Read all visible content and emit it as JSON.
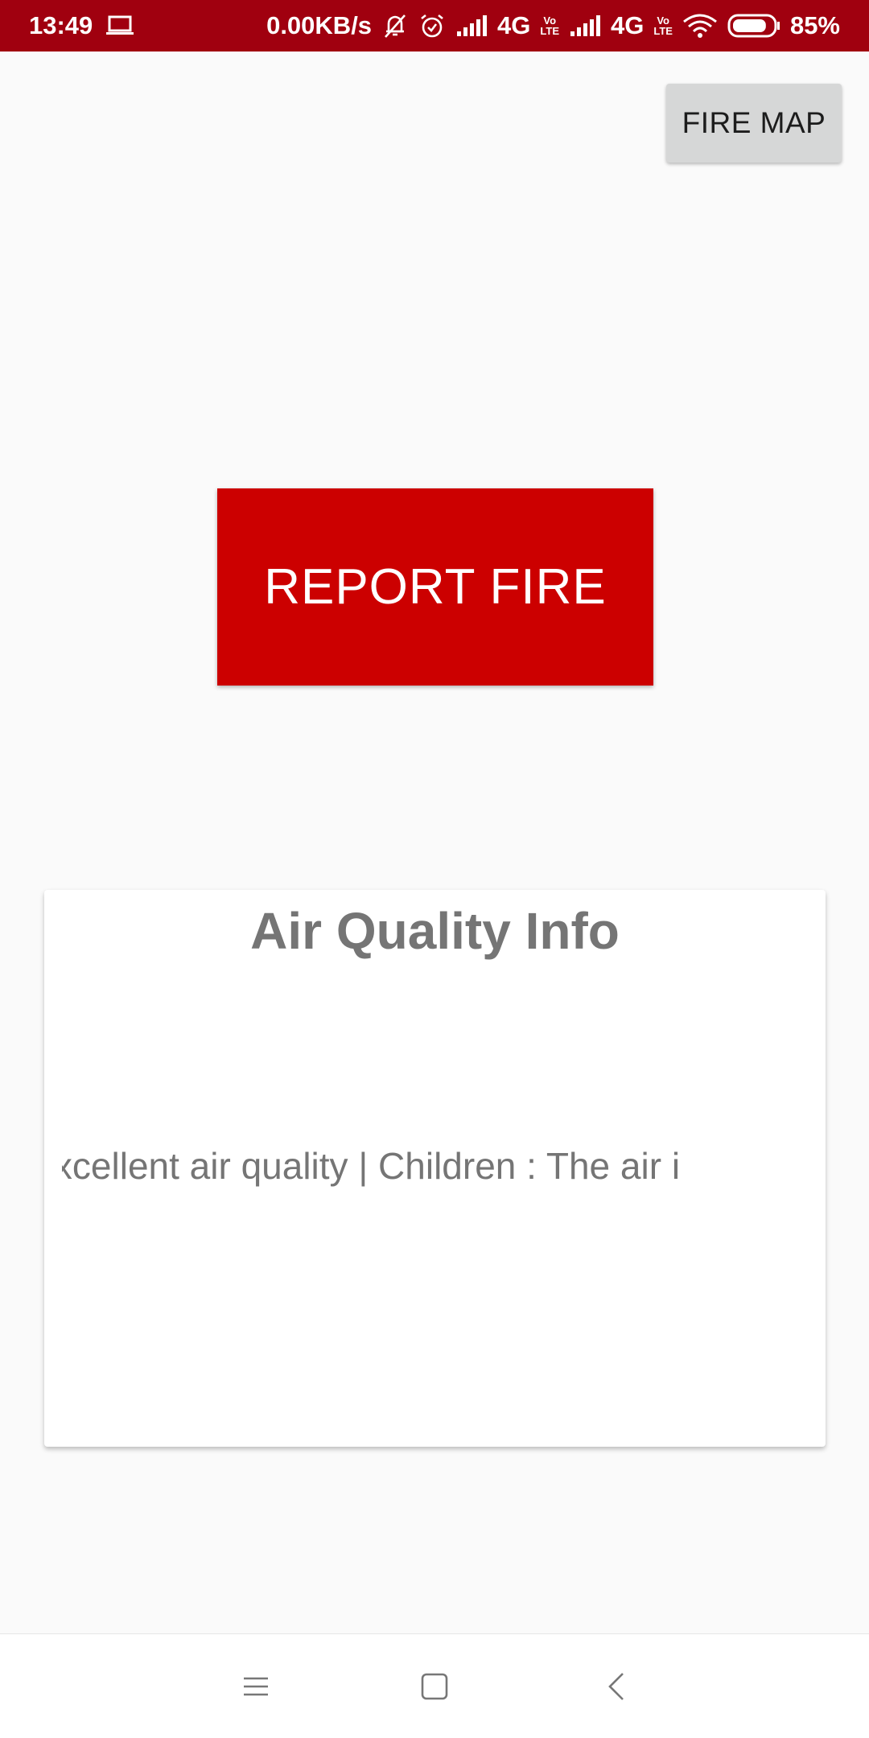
{
  "status_bar": {
    "time": "13:49",
    "network_speed": "0.00KB/s",
    "network_1": "4G",
    "network_2": "4G",
    "lte_1": "LTE",
    "volte_1": "Vo",
    "lte_2": "LTE",
    "volte_2": "Vo",
    "battery_percent": "85%",
    "battery_level": 0.85,
    "background_color": "#a0000f"
  },
  "actions": {
    "fire_map_label": "FIRE MAP",
    "report_fire_label": "REPORT FIRE",
    "report_fire_color": "#cc0000"
  },
  "air_quality": {
    "title": "Air Quality Info",
    "ticker_text": "er : Excellent air quality | Children : The air i"
  },
  "nav_bar": {
    "icons": [
      "menu-icon",
      "home-icon",
      "back-icon"
    ]
  }
}
